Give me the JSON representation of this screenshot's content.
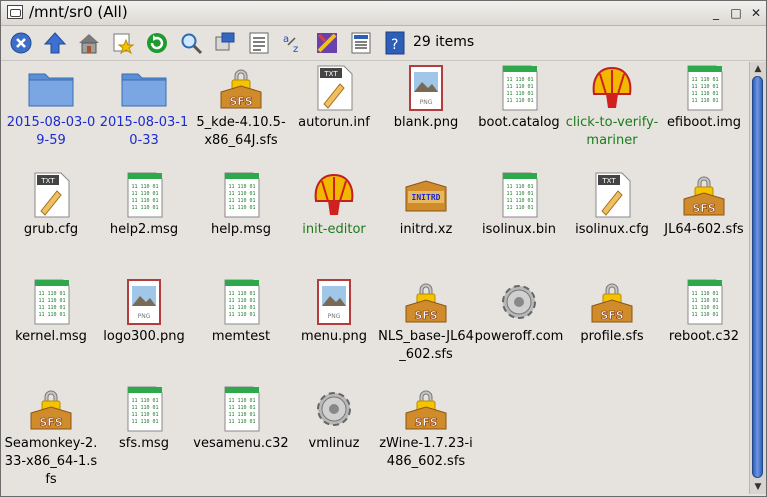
{
  "window": {
    "title": "/mnt/sr0 (All)",
    "icons": {
      "app": "drive-icon",
      "minimize": "minimize-icon",
      "maximize": "maximize-icon",
      "close": "close-icon"
    },
    "controls": {
      "minimize": "_",
      "maximize": "□",
      "close": "✕"
    }
  },
  "toolbar": {
    "buttons": [
      "close-circle-icon",
      "up-arrow-icon",
      "home-icon",
      "bookmark-star-icon",
      "refresh-icon",
      "find-icon",
      "apps-icon",
      "list-view-icon",
      "sort-az-icon",
      "theme-icon",
      "text-view-icon",
      "help-icon"
    ],
    "count_label": "29 items"
  },
  "colors": {
    "folder_label": "#1a2bd1",
    "exec_label": "#1d7a1d",
    "scroll_thumb": "#3a6ac4"
  },
  "scrollbar": {
    "up": "▲",
    "down": "▼"
  },
  "files": [
    {
      "name": "2015-08-03-09-59",
      "type": "folder",
      "style": "blue"
    },
    {
      "name": "2015-08-03-10-33",
      "type": "folder",
      "style": "blue"
    },
    {
      "name": "5_kde-4.10.5-x86_64J.sfs",
      "type": "sfs",
      "style": ""
    },
    {
      "name": "autorun.inf",
      "type": "txt",
      "style": ""
    },
    {
      "name": "blank.png",
      "type": "png",
      "style": ""
    },
    {
      "name": "boot.catalog",
      "type": "bin",
      "style": ""
    },
    {
      "name": "click-to-verify-mariner",
      "type": "shell",
      "style": "green"
    },
    {
      "name": "efiboot.img",
      "type": "bin",
      "style": ""
    },
    {
      "name": "grub.cfg",
      "type": "txt",
      "style": ""
    },
    {
      "name": "help2.msg",
      "type": "bin",
      "style": ""
    },
    {
      "name": "help.msg",
      "type": "bin",
      "style": ""
    },
    {
      "name": "init-editor",
      "type": "shell",
      "style": "green"
    },
    {
      "name": "initrd.xz",
      "type": "initrd",
      "style": ""
    },
    {
      "name": "isolinux.bin",
      "type": "bin",
      "style": ""
    },
    {
      "name": "isolinux.cfg",
      "type": "txt",
      "style": ""
    },
    {
      "name": "JL64-602.sfs",
      "type": "sfs",
      "style": ""
    },
    {
      "name": "kernel.msg",
      "type": "bin",
      "style": ""
    },
    {
      "name": "logo300.png",
      "type": "png",
      "style": ""
    },
    {
      "name": "memtest",
      "type": "bin",
      "style": ""
    },
    {
      "name": "menu.png",
      "type": "png",
      "style": ""
    },
    {
      "name": "NLS_base-JL64_602.sfs",
      "type": "sfs",
      "style": ""
    },
    {
      "name": "poweroff.com",
      "type": "gear",
      "style": ""
    },
    {
      "name": "profile.sfs",
      "type": "sfs",
      "style": ""
    },
    {
      "name": "reboot.c32",
      "type": "bin",
      "style": ""
    },
    {
      "name": "Seamonkey-2.33-x86_64-1.sfs",
      "type": "sfs",
      "style": ""
    },
    {
      "name": "sfs.msg",
      "type": "bin",
      "style": ""
    },
    {
      "name": "vesamenu.c32",
      "type": "bin",
      "style": ""
    },
    {
      "name": "vmlinuz",
      "type": "gear",
      "style": ""
    },
    {
      "name": "zWine-1.7.23-i486_602.sfs",
      "type": "sfs",
      "style": ""
    }
  ],
  "icon_text": {
    "txt": "TXT",
    "png": "PNG",
    "sfs": "SFS",
    "initrd": "INITRD",
    "bin": "11 110 01"
  }
}
